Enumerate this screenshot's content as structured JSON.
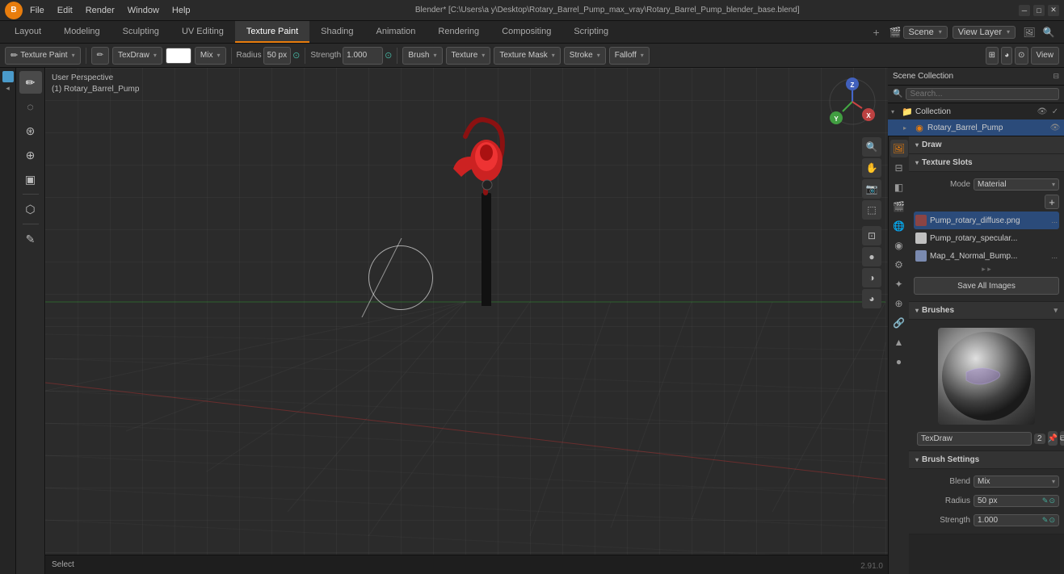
{
  "window": {
    "title": "Blender* [C:\\Users\\a y\\Desktop\\Rotary_Barrel_Pump_max_vray\\Rotary_Barrel_Pump_blender_base.blend]",
    "version": "2.91.0"
  },
  "menus": {
    "items": [
      "Blender",
      "File",
      "Edit",
      "Render",
      "Window",
      "Help"
    ]
  },
  "workspaces": {
    "tabs": [
      "Layout",
      "Modeling",
      "Sculpting",
      "UV Editing",
      "Texture Paint",
      "Shading",
      "Animation",
      "Rendering",
      "Compositing",
      "Scripting"
    ],
    "active": "Texture Paint",
    "add_label": "+",
    "scene": "Scene",
    "view_layer": "View Layer"
  },
  "header_toolbar": {
    "mode_label": "Texture Paint",
    "draw_label": "TexDraw",
    "color_label": "Mix",
    "radius_label": "Radius",
    "radius_value": "50 px",
    "strength_label": "Strength",
    "strength_value": "1.000",
    "brush_label": "Brush",
    "texture_label": "Texture",
    "mask_label": "Texture Mask",
    "stroke_label": "Stroke",
    "falloff_label": "Falloff",
    "view_menu": "View"
  },
  "viewport": {
    "perspective_label": "User Perspective",
    "object_label": "(1) Rotary_Barrel_Pump"
  },
  "outliner": {
    "scene_collection": "Scene Collection",
    "items": [
      {
        "name": "Collection",
        "level": 0,
        "type": "collection",
        "expanded": true
      },
      {
        "name": "Rotary_Barrel_Pump",
        "level": 1,
        "type": "object",
        "selected": true
      }
    ]
  },
  "properties": {
    "draw_label": "Draw",
    "texture_slots_label": "Texture Slots",
    "mode_label": "Mode",
    "mode_value": "Material",
    "slots": [
      {
        "name": "Pump_rotary_diffuse.png",
        "color": "#8b4444",
        "active": true,
        "dots": "..."
      },
      {
        "name": "Pump_rotary_specular...",
        "color": "#c0c0c0",
        "active": false,
        "dots": ""
      },
      {
        "name": "Map_4_Normal_Bump...",
        "color": "#7a8ab0",
        "active": false,
        "dots": "..."
      }
    ],
    "save_all_label": "Save All Images",
    "brushes_label": "Brushes",
    "brush_name": "TexDraw",
    "brush_count": "2",
    "brush_settings_label": "Brush Settings",
    "blend_label": "Blend",
    "blend_value": "Mix",
    "radius_label": "Radius",
    "radius_value": "50 px",
    "strength_label": "Strength",
    "strength_value": "1.000"
  },
  "status_bar": {
    "select_label": "Select"
  },
  "icons": {
    "blender": "B",
    "arrow_down": "▾",
    "arrow_right": "▸",
    "arrow_up": "▴",
    "check": "✓",
    "eye": "👁",
    "plus": "+",
    "collapse": "▾",
    "expand": "▸",
    "close": "✕",
    "duplicate": "⧉",
    "pin": "📌",
    "search": "🔍",
    "brush": "✏",
    "texture": "◧",
    "camera": "📷",
    "object": "◉",
    "collection": "📁",
    "scene": "🎬",
    "render": "🖼",
    "world": "🌐",
    "material": "●",
    "particle": "✦",
    "physics": "⚙"
  }
}
